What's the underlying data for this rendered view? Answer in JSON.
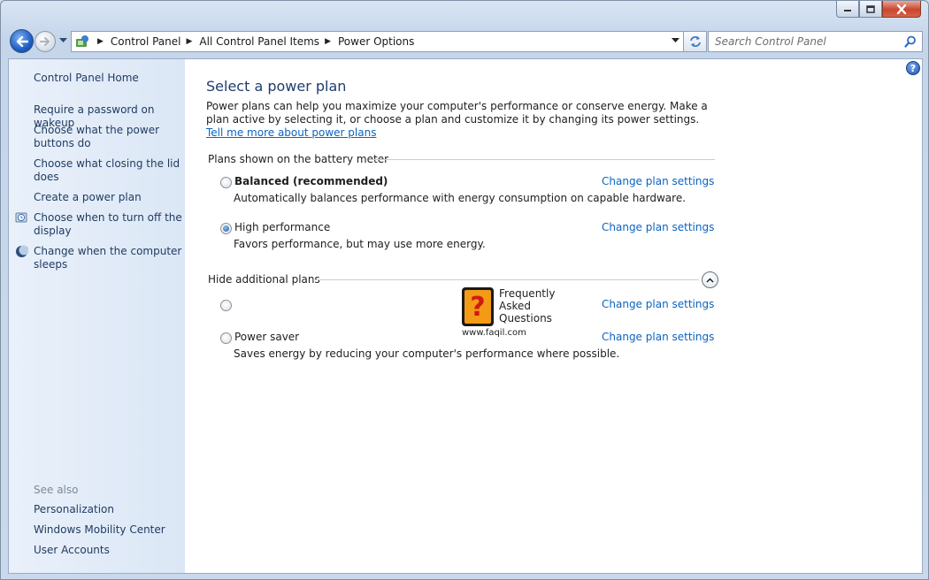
{
  "window": {
    "minimize_icon": "minimize-icon",
    "maximize_icon": "maximize-icon",
    "close_icon": "close-icon"
  },
  "navbar": {
    "breadcrumb": [
      "Control Panel",
      "All Control Panel Items",
      "Power Options"
    ],
    "search_placeholder": "Search Control Panel"
  },
  "sidebar": {
    "home": "Control Panel Home",
    "links": [
      "Require a password on wakeup",
      "Choose what the power buttons do",
      "Choose what closing the lid does",
      "Create a power plan",
      "Choose when to turn off the display",
      "Change when the computer sleeps"
    ],
    "see_also_title": "See also",
    "see_also": [
      "Personalization",
      "Windows Mobility Center",
      "User Accounts"
    ]
  },
  "main": {
    "title": "Select a power plan",
    "intro": "Power plans can help you maximize your computer's performance or conserve energy. Make a plan active by selecting it, or choose a plan and customize it by changing its power settings.",
    "intro_link": "Tell me more about power plans",
    "battery_group": "Plans shown on the battery meter",
    "hidden_group": "Hide additional plans",
    "change_link": "Change plan settings",
    "plans": [
      {
        "name": "Balanced (recommended)",
        "description": "Automatically balances performance with energy consumption on capable hardware.",
        "selected": false
      },
      {
        "name": "High performance",
        "description": "Favors performance, but may use more energy.",
        "selected": true
      },
      {
        "name": "",
        "description": "",
        "selected": false
      },
      {
        "name": "Power saver",
        "description": "Saves energy by reducing your computer's performance where possible.",
        "selected": false
      }
    ],
    "watermark": {
      "lines": [
        "Frequently",
        "Asked",
        "Questions"
      ],
      "url": "www.faqil.com",
      "mark": "?"
    }
  }
}
